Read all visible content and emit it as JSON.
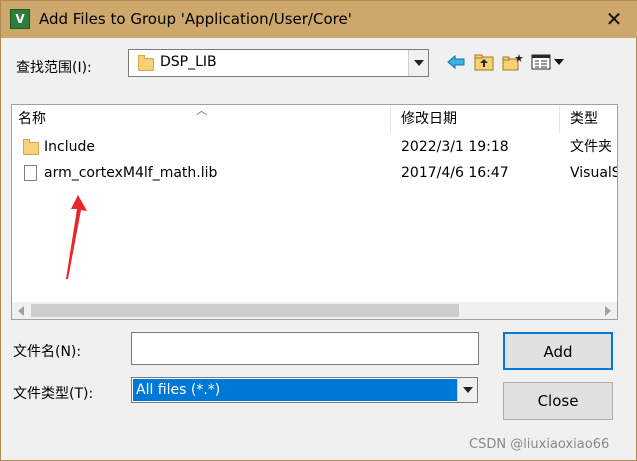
{
  "window": {
    "title": "Add Files to Group 'Application/User/Core'",
    "app_icon_glyph": "V"
  },
  "lookin": {
    "label": "查找范围(I):",
    "value": "DSP_LIB"
  },
  "list": {
    "columns": [
      "名称",
      "修改日期",
      "类型"
    ],
    "rows": [
      {
        "name": "Include",
        "date": "2022/3/1 19:18",
        "type": "文件夹",
        "icon": "folder-icon"
      },
      {
        "name": "arm_cortexM4lf_math.lib",
        "date": "2017/4/6 16:47",
        "type": "VisualS",
        "icon": "file-icon"
      }
    ]
  },
  "filename": {
    "label": "文件名(N):",
    "value": ""
  },
  "filetype": {
    "label": "文件类型(T):",
    "value": "All files (*.*)"
  },
  "buttons": {
    "add": "Add",
    "close": "Close"
  },
  "watermark": "CSDN @liuxiaoxiao66",
  "colors": {
    "titlebar": "#cda76b",
    "selection": "#0078d7",
    "annotation_arrow": "#e8262b"
  }
}
